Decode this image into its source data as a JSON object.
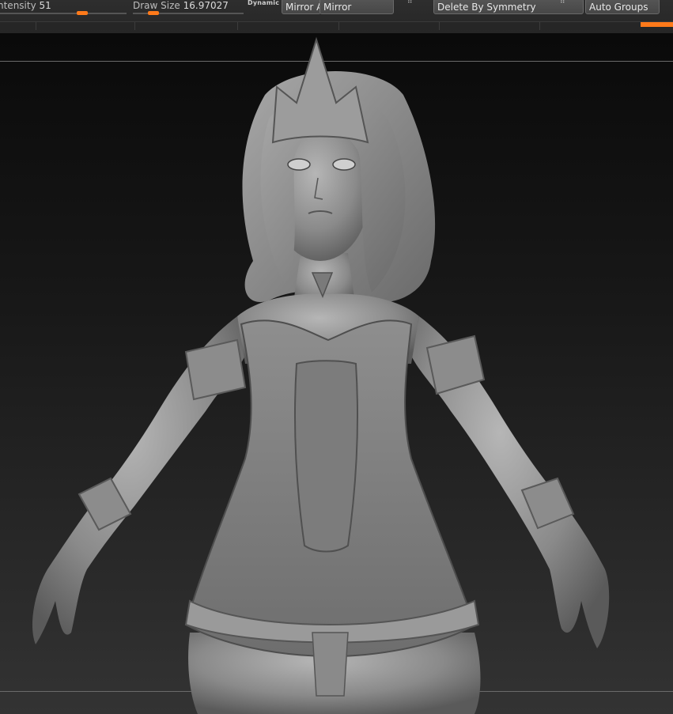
{
  "toolbar": {
    "intensity_label": "ntensity",
    "intensity_value": "51",
    "draw_size_label": "Draw Size",
    "draw_size_value": "16.97027",
    "dynamic_label": "Dynamic",
    "buttons": {
      "mirror_and_weld": "Mirror A",
      "mirror": "Mirror",
      "delete_by_symmetry": "Delete By Symmetry",
      "auto_groups": "Auto Groups"
    },
    "accent_color": "#ff7a1a"
  },
  "viewport": {
    "subject": "sculpted-character-model",
    "background": "#1c1c1c"
  }
}
